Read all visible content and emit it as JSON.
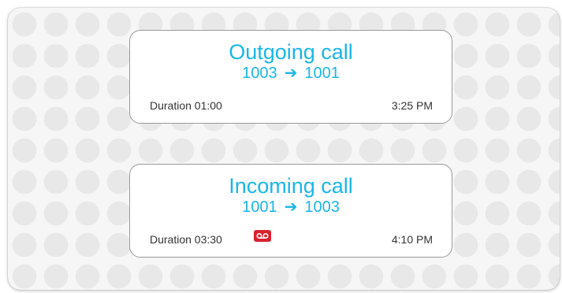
{
  "calls": [
    {
      "title": "Outgoing call",
      "from": "1003",
      "to": "1001",
      "arrow": "➔",
      "duration": "Duration 01:00",
      "time": "3:25 PM",
      "voicemail": false
    },
    {
      "title": "Incoming call",
      "from": "1001",
      "to": "1003",
      "arrow": "➔",
      "duration": "Duration 03:30",
      "time": "4:10 PM",
      "voicemail": true,
      "voicemail_icon": "voicemail-icon"
    }
  ],
  "colors": {
    "accent": "#1ab6e8",
    "voicemail_badge": "#d8232f",
    "text": "#333333",
    "card_border": "#9a9a9a"
  }
}
